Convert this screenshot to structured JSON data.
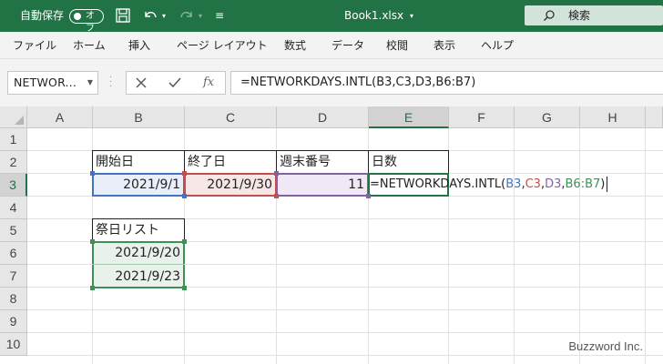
{
  "titlebar": {
    "autosave_label": "自動保存",
    "autosave_state": "オフ",
    "file_name": "Book1.xlsx",
    "search_label": "検索",
    "bg_color": "#217346"
  },
  "menu": {
    "items": [
      "ファイル",
      "ホーム",
      "挿入",
      "ページ レイアウト",
      "数式",
      "データ",
      "校閲",
      "表示",
      "ヘルプ"
    ]
  },
  "formula_bar": {
    "name_box": "NETWOR...",
    "fx_label": "fx",
    "formula": "=NETWORKDAYS.INTL(B3,C3,D3,B6:B7)"
  },
  "grid": {
    "columns": [
      "A",
      "B",
      "C",
      "D",
      "E",
      "F",
      "G",
      "H"
    ],
    "selected_column": "E",
    "rows": [
      "1",
      "2",
      "3",
      "4",
      "5",
      "6",
      "7",
      "8",
      "9",
      "10"
    ],
    "selected_row": "3",
    "cells": {
      "B2": "開始日",
      "C2": "終了日",
      "D2": "週末番号",
      "E2": "日数",
      "B3": "2021/9/1",
      "C3": "2021/9/30",
      "D3": "11",
      "B5": "祭日リスト",
      "B6": "2021/9/20",
      "B7": "2021/9/23"
    },
    "edit_formula": {
      "prefix": "=NETWORKDAYS.INTL(",
      "ref_b3": "B3",
      "ref_c3": "C3",
      "ref_d3": "D3",
      "ref_b6b7": "B6:B7",
      "comma": ",",
      "suffix": ")"
    },
    "colors": {
      "ref_blue": "#4472c4",
      "ref_red": "#c0504d",
      "ref_purple": "#8064a2",
      "ref_green": "#3f8f56"
    }
  },
  "watermark": "Buzzword Inc."
}
